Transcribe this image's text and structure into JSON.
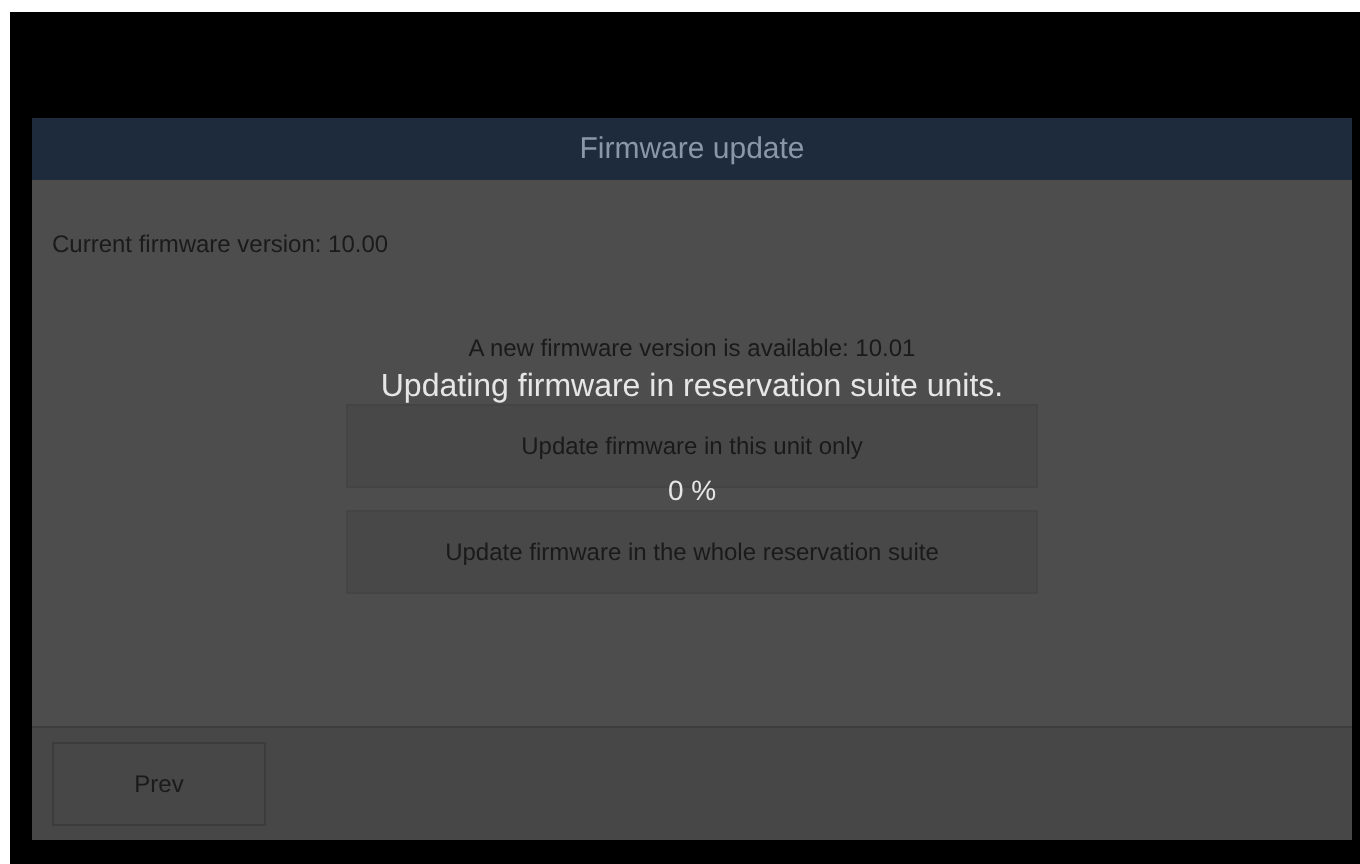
{
  "dialog": {
    "title": "Firmware update",
    "current_version": "Current firmware version: 10.00",
    "available_version": "A new firmware version is available: 10.01",
    "buttons": [
      "Update firmware in this unit only",
      "Update firmware in the whole reservation suite"
    ],
    "footer_buttons": [
      "Prev"
    ]
  },
  "progress_overlay": {
    "message": "Updating firmware in reservation suite units.",
    "percent": "0 %"
  }
}
